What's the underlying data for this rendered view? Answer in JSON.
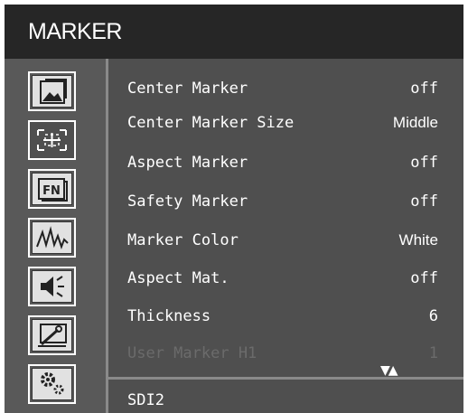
{
  "header": {
    "title": "MARKER"
  },
  "sidebar": {
    "icons": [
      {
        "name": "picture-icon",
        "active": false
      },
      {
        "name": "marker-icon",
        "active": true
      },
      {
        "name": "function-key-icon",
        "label": "FN",
        "active": false
      },
      {
        "name": "waveform-icon",
        "active": false
      },
      {
        "name": "speaker-icon",
        "active": false
      },
      {
        "name": "system-setup-icon",
        "active": false
      },
      {
        "name": "gear-icon",
        "active": false
      }
    ]
  },
  "menu": {
    "items": [
      {
        "label": "Center Marker",
        "value": "off"
      },
      {
        "label": "Center Marker Size",
        "value": "Middle"
      },
      {
        "label": "Aspect Marker",
        "value": "off"
      },
      {
        "label": "Safety Marker",
        "value": "off"
      },
      {
        "label": "Marker Color",
        "value": "White"
      },
      {
        "label": "Aspect Mat.",
        "value": "off"
      },
      {
        "label": "Thickness",
        "value": "6"
      },
      {
        "label": "User Marker H1",
        "value": "1",
        "disabled": true
      }
    ],
    "scroll_arrows": "▼▲"
  },
  "footer": {
    "source": "SDI2"
  },
  "colors": {
    "background": "#4f4f4f",
    "title_bar": "#262626",
    "disabled_text": "#6b6b6b"
  }
}
